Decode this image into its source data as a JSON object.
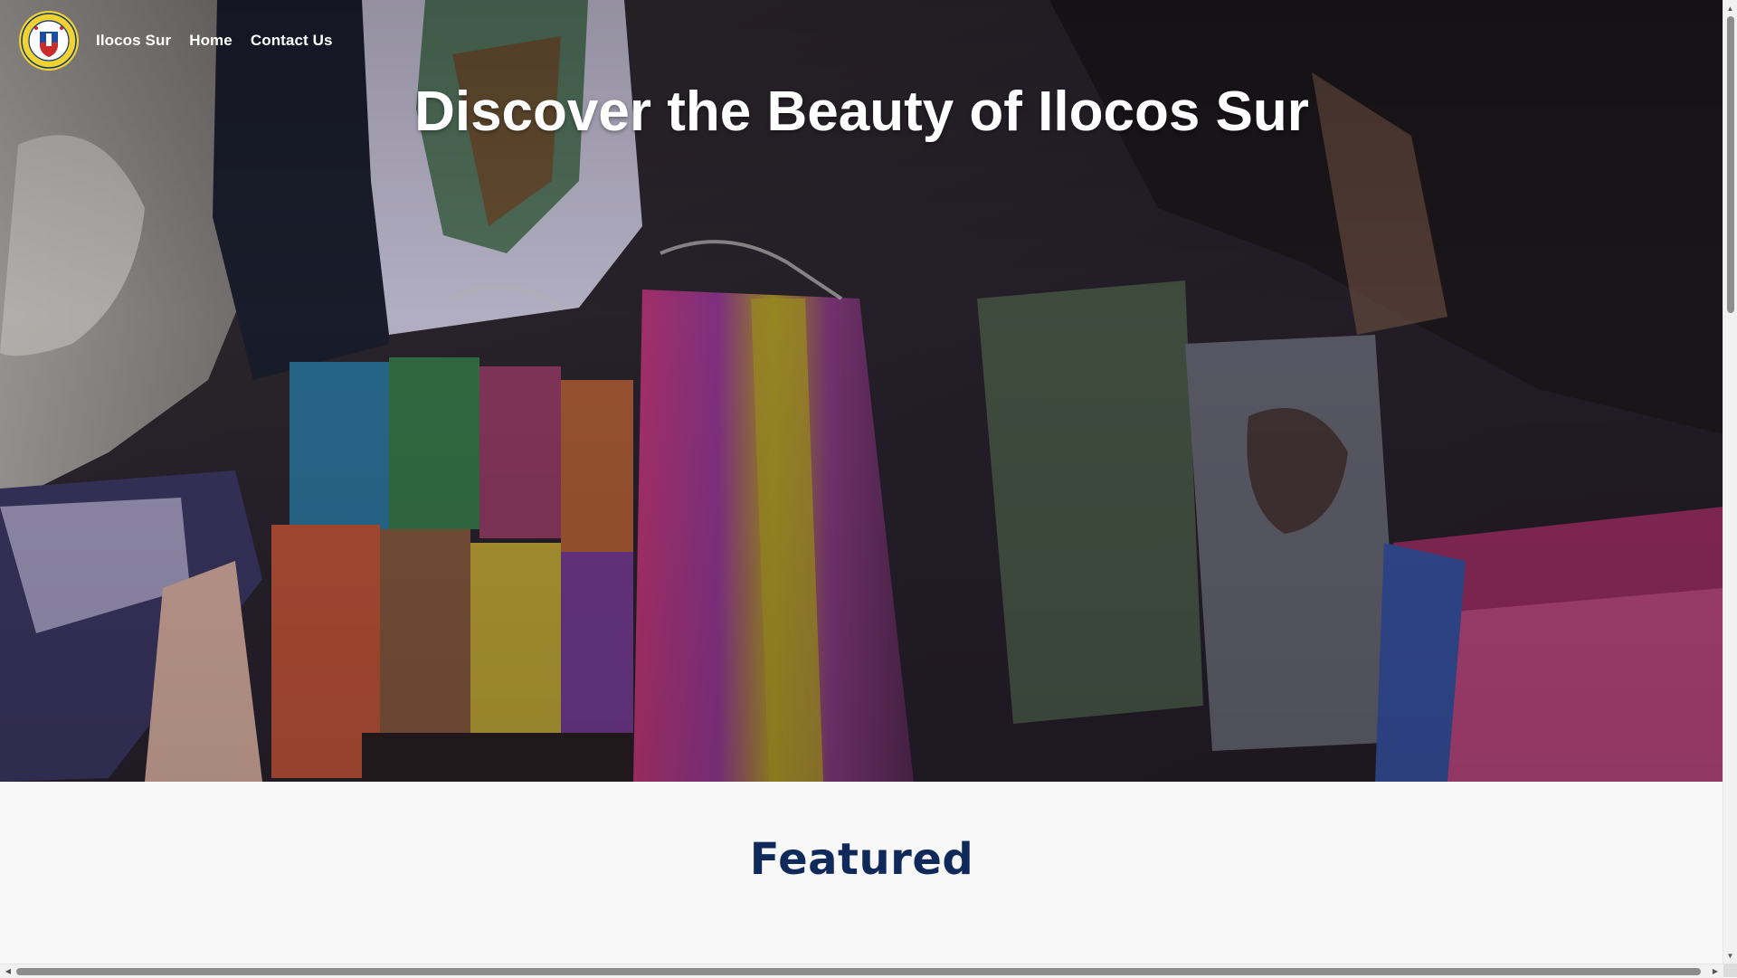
{
  "nav": {
    "brand": "Ilocos Sur",
    "links": [
      "Home",
      "Contact Us"
    ],
    "seal_icon": "provincial-seal-icon"
  },
  "hero": {
    "title": "Discover the Beauty of Ilocos Sur"
  },
  "featured": {
    "title": "Featured"
  },
  "colors": {
    "nav_text": "#ffffff",
    "hero_title": "#ffffff",
    "featured_title": "#0f2a5a",
    "featured_bg": "#f8f8f8"
  },
  "scrollbars": {
    "vertical_icon_up": "arrow-up-icon",
    "vertical_icon_down": "arrow-down-icon",
    "horizontal_icon_left": "arrow-left-icon",
    "horizontal_icon_right": "arrow-right-icon"
  }
}
